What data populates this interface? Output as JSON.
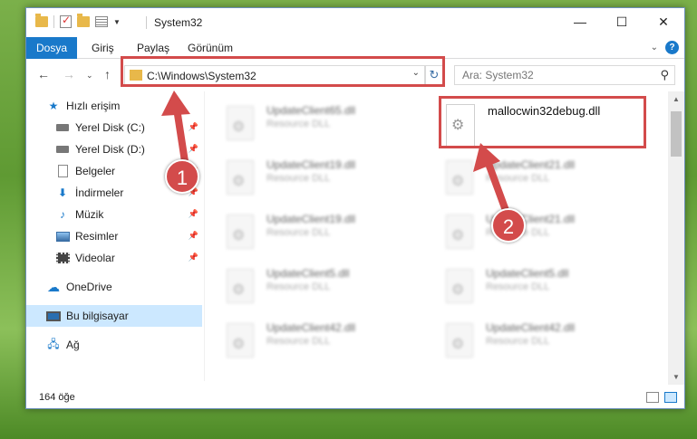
{
  "window": {
    "title": "System32"
  },
  "ribbon": {
    "tabs": [
      "Dosya",
      "Giriş",
      "Paylaş",
      "Görünüm"
    ]
  },
  "nav": {
    "address_path": "C:\\Windows\\System32",
    "search_placeholder": "Ara: System32"
  },
  "sidebar": {
    "items": [
      {
        "label": "Hızlı erişim",
        "icon": "star-icon"
      },
      {
        "label": "Yerel Disk (C:)",
        "icon": "drive-icon",
        "pinned": true
      },
      {
        "label": "Yerel Disk (D:)",
        "icon": "drive-icon",
        "pinned": true
      },
      {
        "label": "Belgeler",
        "icon": "document-icon",
        "pinned": true
      },
      {
        "label": "İndirmeler",
        "icon": "download-icon",
        "pinned": true
      },
      {
        "label": "Müzik",
        "icon": "music-icon",
        "pinned": true
      },
      {
        "label": "Resimler",
        "icon": "pictures-icon",
        "pinned": true
      },
      {
        "label": "Videolar",
        "icon": "video-icon",
        "pinned": true
      },
      {
        "label": "OneDrive",
        "icon": "cloud-icon"
      },
      {
        "label": "Bu bilgisayar",
        "icon": "computer-icon",
        "selected": true
      },
      {
        "label": "Ağ",
        "icon": "network-icon"
      }
    ]
  },
  "files": [
    {
      "name": "UpdateClient65.dll",
      "type": "Resource DLL"
    },
    {
      "name": "mallocwin32debug.dll",
      "type": ""
    },
    {
      "name": "UpdateClient19.dll",
      "type": "Resource DLL"
    },
    {
      "name": "UpdateClient21.dll",
      "type": "Resource DLL"
    },
    {
      "name": "UpdateClient19.dll",
      "type": "Resource DLL"
    },
    {
      "name": "UpdateClient21.dll",
      "type": "Resource DLL"
    },
    {
      "name": "UpdateClient5.dll",
      "type": "Resource DLL"
    },
    {
      "name": "UpdateClient5.dll",
      "type": "Resource DLL"
    },
    {
      "name": "UpdateClient42.dll",
      "type": "Resource DLL"
    },
    {
      "name": "UpdateClient42.dll",
      "type": "Resource DLL"
    }
  ],
  "status": {
    "item_count": "164 öğe"
  },
  "callouts": {
    "one": "1",
    "two": "2"
  },
  "colors": {
    "accent": "#1979ca",
    "highlight": "#d34b4b"
  }
}
